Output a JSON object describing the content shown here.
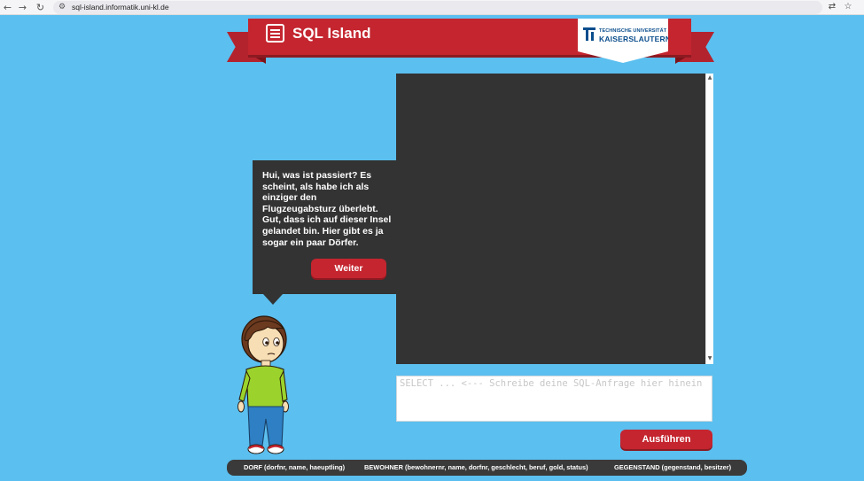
{
  "browser": {
    "back_icon": "arrow-left-icon",
    "forward_icon": "arrow-right-icon",
    "reload_icon": "reload-icon",
    "back_glyph": "←",
    "forward_glyph": "→",
    "reload_glyph": "↻",
    "site_settings_glyph": "⚙",
    "translate_glyph": "⇄",
    "bookmark_glyph": "☆",
    "url": "sql-island.informatik.uni-kl.de"
  },
  "header": {
    "title": "SQL Island",
    "university_line1": "TECHNISCHE UNIVERSITÄT",
    "university_line2": "KAISERSLAUTERN"
  },
  "dialog": {
    "text": "Hui, was ist passiert? Es scheint, als habe ich als einziger den Flugzeugabsturz überlebt. Gut, dass ich auf dieser Insel gelandet bin. Hier gibt es ja sogar ein paar Dörfer.",
    "next_button": "Weiter"
  },
  "scrollbar": {
    "up_glyph": "▲",
    "down_glyph": "▼"
  },
  "query": {
    "value": "",
    "placeholder": "SELECT ... <--- Schreibe deine SQL-Anfrage hier hinein",
    "run_button": "Ausführen"
  },
  "schema": [
    "DORF (dorfnr, name, haeuptling)",
    "BEWOHNER (bewohnernr, name, dorfnr, geschlecht, beruf, gold, status)",
    "GEGENSTAND (gegenstand, besitzer)"
  ],
  "colors": {
    "background": "#5bbfef",
    "accent_red": "#c4252f",
    "panel_dark": "#333333"
  }
}
